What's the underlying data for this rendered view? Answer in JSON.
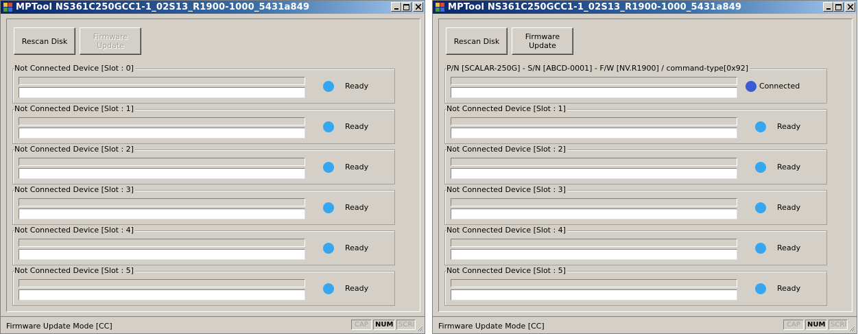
{
  "windows": [
    {
      "title": "MPTool NS361C250GCC1-1_02S13_R1900-1000_5431a849",
      "buttons": {
        "rescan": "Rescan Disk",
        "firmware": "Firmware\nUpdate",
        "firmware_enabled": false
      },
      "slots": [
        {
          "label": "Not Connected Device [Slot : 0]",
          "status": "Ready",
          "led_color": "#35a7f0"
        },
        {
          "label": "Not Connected Device [Slot : 1]",
          "status": "Ready",
          "led_color": "#35a7f0"
        },
        {
          "label": "Not Connected Device [Slot : 2]",
          "status": "Ready",
          "led_color": "#35a7f0"
        },
        {
          "label": "Not Connected Device [Slot : 3]",
          "status": "Ready",
          "led_color": "#35a7f0"
        },
        {
          "label": "Not Connected Device [Slot : 4]",
          "status": "Ready",
          "led_color": "#35a7f0"
        },
        {
          "label": "Not Connected Device [Slot : 5]",
          "status": "Ready",
          "led_color": "#35a7f0"
        }
      ],
      "statusbar": {
        "mode": "Firmware Update Mode [CC]",
        "cap": "CAP",
        "num": "NUM",
        "scrl": "SCRl"
      }
    },
    {
      "title": "MPTool NS361C250GCC1-1_02S13_R1900-1000_5431a849",
      "buttons": {
        "rescan": "Rescan Disk",
        "firmware": "Firmware\nUpdate",
        "firmware_enabled": true
      },
      "slots": [
        {
          "label": "P/N [SCALAR-250G] - S/N [ABCD-0001] - F/W [NV.R1900] / command-type[0x92]",
          "status": "Connected",
          "led_color": "#3a5bd4"
        },
        {
          "label": "Not Connected Device [Slot : 1]",
          "status": "Ready",
          "led_color": "#35a7f0"
        },
        {
          "label": "Not Connected Device [Slot : 2]",
          "status": "Ready",
          "led_color": "#35a7f0"
        },
        {
          "label": "Not Connected Device [Slot : 3]",
          "status": "Ready",
          "led_color": "#35a7f0"
        },
        {
          "label": "Not Connected Device [Slot : 4]",
          "status": "Ready",
          "led_color": "#35a7f0"
        },
        {
          "label": "Not Connected Device [Slot : 5]",
          "status": "Ready",
          "led_color": "#35a7f0"
        }
      ],
      "statusbar": {
        "mode": "Firmware Update Mode [CC]",
        "cap": "CAP",
        "num": "NUM",
        "scrl": "SCRl"
      }
    }
  ]
}
